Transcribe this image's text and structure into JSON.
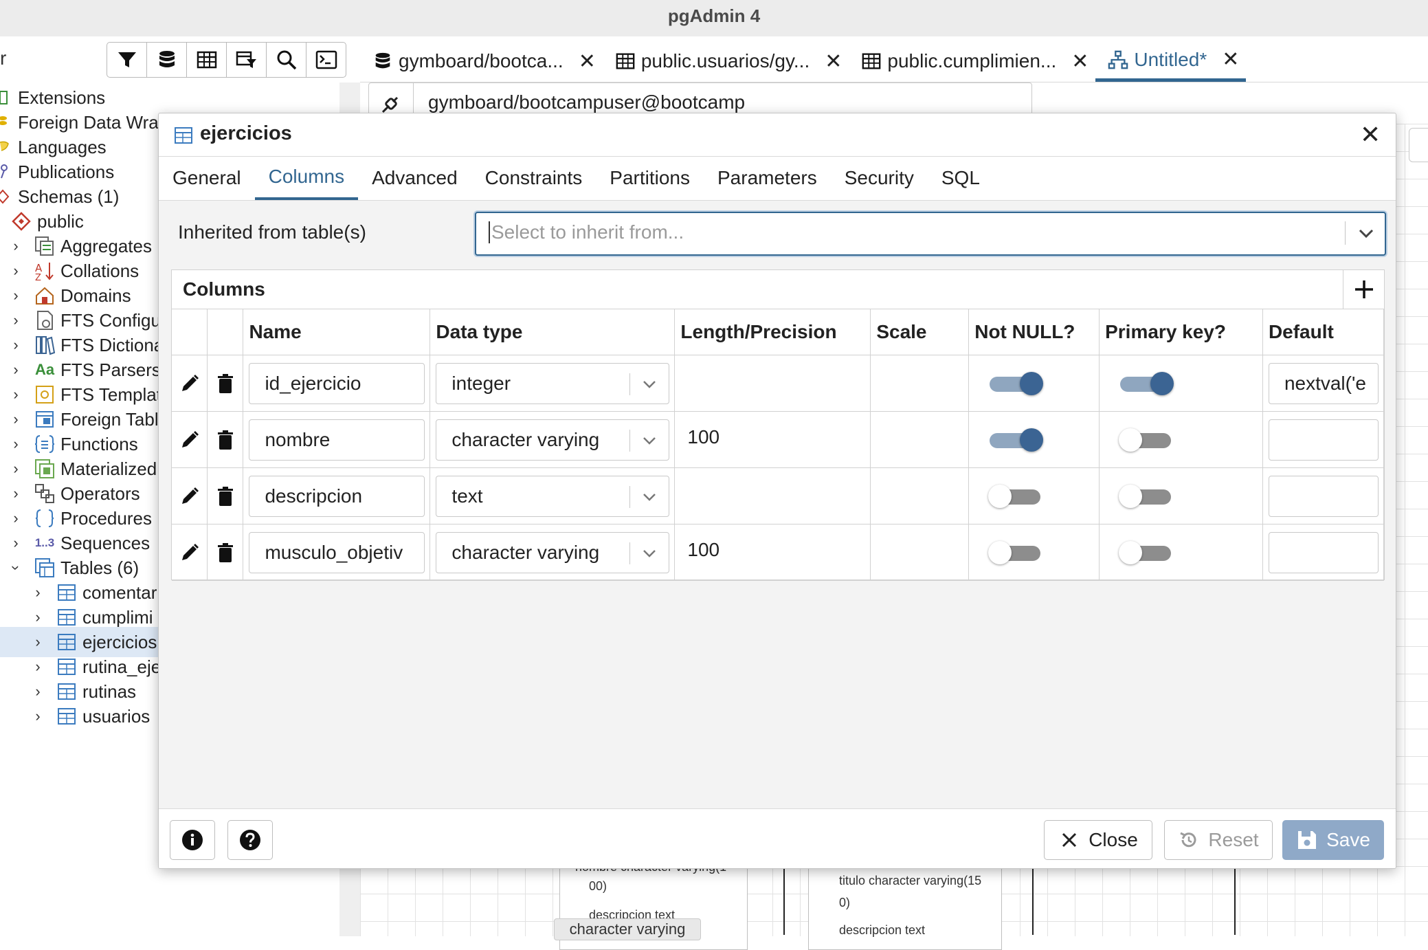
{
  "window": {
    "title": "pgAdmin 4"
  },
  "left_toolbar": {
    "partial_text": "r",
    "tools": [
      "filter-icon",
      "database-icon",
      "table-icon",
      "table-filter-icon",
      "search-icon",
      "terminal-icon"
    ]
  },
  "tree": {
    "items": [
      {
        "label": "Extensions",
        "icon": "extensions-icon"
      },
      {
        "label": "Foreign Data Wrap",
        "icon": "foreign-data-wrapper-icon"
      },
      {
        "label": "Languages",
        "icon": "languages-icon"
      },
      {
        "label": "Publications",
        "icon": "publications-icon"
      },
      {
        "label": "Schemas (1)",
        "icon": "schemas-icon"
      },
      {
        "label": "public",
        "icon": "schema-icon"
      },
      {
        "label": "Aggregates",
        "icon": "aggregates-icon"
      },
      {
        "label": "Collations",
        "icon": "collations-icon"
      },
      {
        "label": "Domains",
        "icon": "domains-icon"
      },
      {
        "label": "FTS Configu",
        "icon": "fts-config-icon"
      },
      {
        "label": "FTS Dictiona",
        "icon": "fts-dictionary-icon"
      },
      {
        "label": "FTS Parsers",
        "icon": "fts-parser-icon",
        "glyph": "Aa"
      },
      {
        "label": "FTS Templat",
        "icon": "fts-template-icon"
      },
      {
        "label": "Foreign Tabl",
        "icon": "foreign-table-icon"
      },
      {
        "label": "Functions",
        "icon": "functions-icon"
      },
      {
        "label": "Materialized",
        "icon": "materialized-view-icon"
      },
      {
        "label": "Operators",
        "icon": "operators-icon"
      },
      {
        "label": "Procedures",
        "icon": "procedures-icon"
      },
      {
        "label": "Sequences",
        "icon": "sequences-icon",
        "glyph": "1..3"
      },
      {
        "label": "Tables (6)",
        "icon": "tables-icon"
      },
      {
        "label": "comentar",
        "icon": "table-icon"
      },
      {
        "label": "cumplimi",
        "icon": "table-icon"
      },
      {
        "label": "ejercicios",
        "icon": "table-icon"
      },
      {
        "label": "rutina_eje",
        "icon": "table-icon"
      },
      {
        "label": "rutinas",
        "icon": "table-icon"
      },
      {
        "label": "usuarios",
        "icon": "table-icon"
      }
    ]
  },
  "tabs": [
    {
      "label": "gymboard/bootca...",
      "icon": "database-icon"
    },
    {
      "label": "public.usuarios/gy...",
      "icon": "table-icon"
    },
    {
      "label": "public.cumplimien...",
      "icon": "table-icon"
    },
    {
      "label": "Untitled*",
      "icon": "erd-icon",
      "active": true
    }
  ],
  "connection": {
    "text": "gymboard/bootcampuser@bootcamp"
  },
  "erd": {
    "left_card_lines": [
      "nombre character varying(1",
      "00)",
      "descripcion text"
    ],
    "right_card_lines": [
      "titulo character varying(15",
      "0)",
      "descripcion text"
    ],
    "tooltip": "character varying"
  },
  "dialog": {
    "title": "ejercicios",
    "tabs": [
      "General",
      "Columns",
      "Advanced",
      "Constraints",
      "Partitions",
      "Parameters",
      "Security",
      "SQL"
    ],
    "active_tab": "Columns",
    "inherit_label": "Inherited from table(s)",
    "inherit_placeholder": "Select to inherit from...",
    "grid_title": "Columns",
    "headers": [
      "Name",
      "Data type",
      "Length/Precision",
      "Scale",
      "Not NULL?",
      "Primary key?",
      "Default"
    ],
    "rows": [
      {
        "name": "id_ejercicio",
        "type": "integer",
        "length": "",
        "scale": "",
        "not_null": true,
        "primary_key": true,
        "default": "nextval('e"
      },
      {
        "name": "nombre",
        "type": "character varying",
        "length": "100",
        "scale": "",
        "not_null": true,
        "primary_key": false,
        "default": ""
      },
      {
        "name": "descripcion",
        "type": "text",
        "length": "",
        "scale": "",
        "not_null": false,
        "primary_key": false,
        "default": ""
      },
      {
        "name": "musculo_objetiv",
        "type": "character varying",
        "length": "100",
        "scale": "",
        "not_null": false,
        "primary_key": false,
        "default": ""
      }
    ],
    "footer": {
      "close": "Close",
      "reset": "Reset",
      "save": "Save"
    }
  },
  "colors": {
    "accent": "#326690",
    "toggle_on": "#3b6493",
    "save_disabled": "#8fa9c8"
  }
}
